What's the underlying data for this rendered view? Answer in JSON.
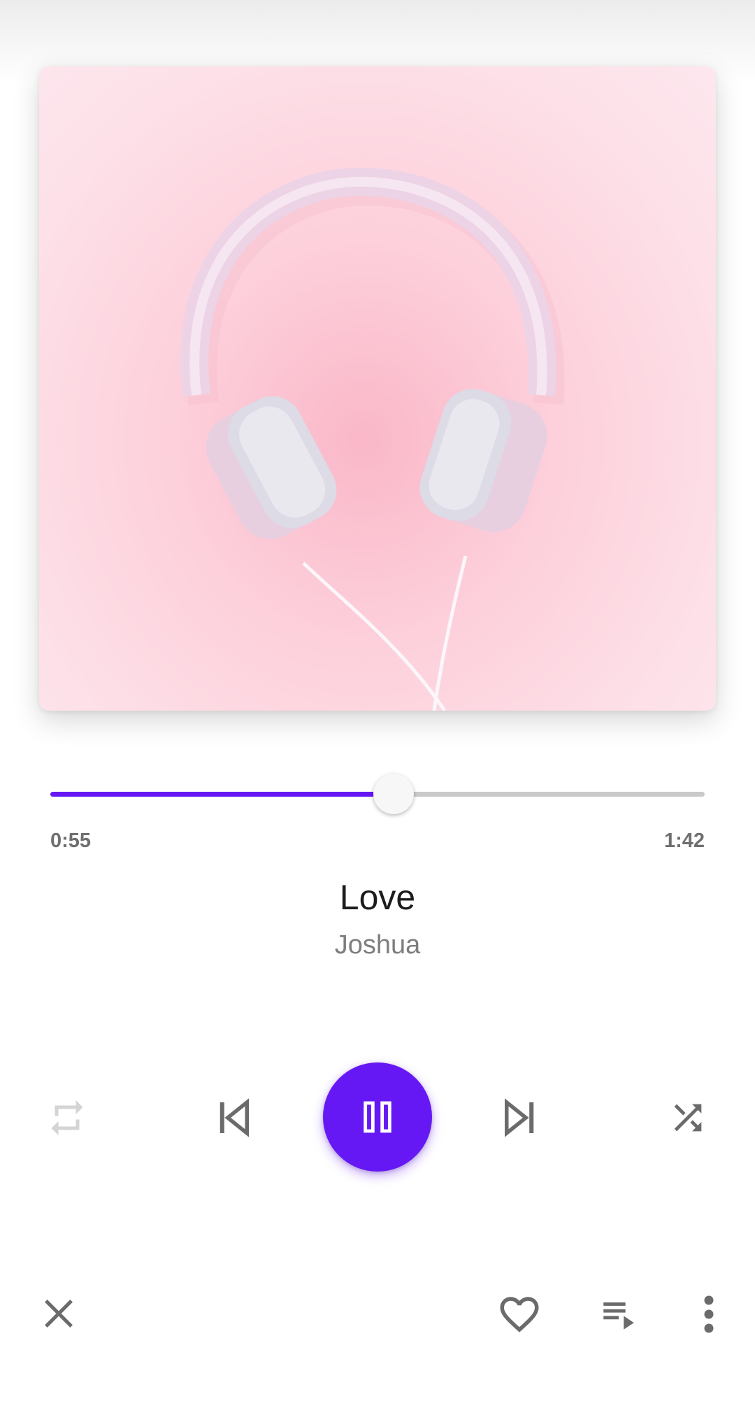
{
  "player": {
    "elapsed": "0:55",
    "duration": "1:42",
    "progress_fraction": 0.525,
    "title": "Love",
    "artist": "Joshua",
    "accent_color": "#6518f4"
  },
  "artwork": {
    "subject": "pink-headphones-on-pink-background"
  },
  "controls": {
    "repeat_icon": "repeat-icon",
    "previous_icon": "skip-previous-icon",
    "play_pause_icon": "pause-icon",
    "next_icon": "skip-next-icon",
    "shuffle_icon": "shuffle-icon"
  },
  "bottom_bar": {
    "close_icon": "close-icon",
    "favorite_icon": "heart-outline-icon",
    "queue_icon": "queue-music-icon",
    "more_icon": "more-vertical-icon"
  }
}
